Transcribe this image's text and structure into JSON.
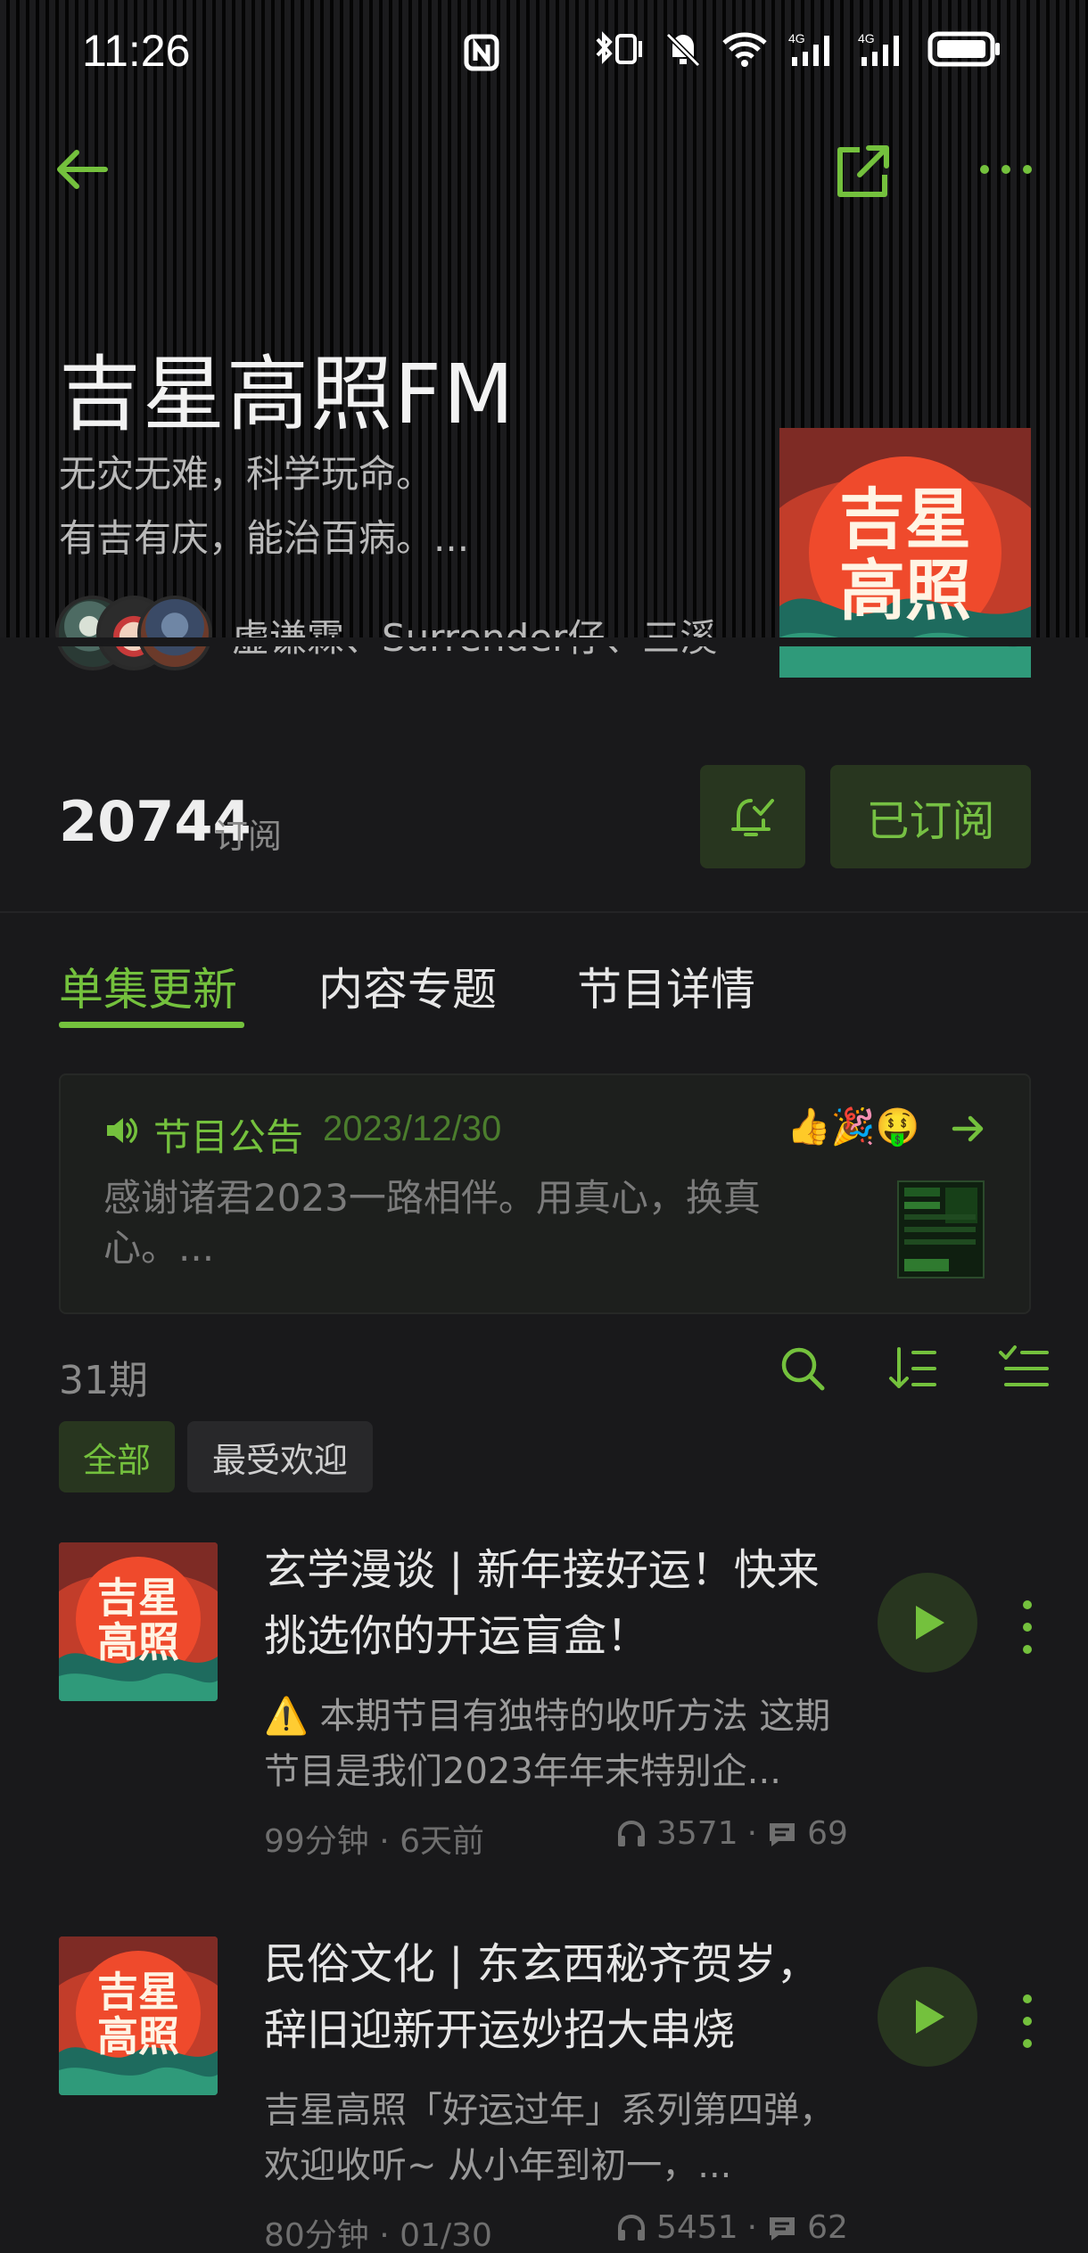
{
  "status_bar": {
    "time": "11:26"
  },
  "header": {
    "title": "吉星高照FM",
    "description_lines": [
      "无灾无难，科学玩命。",
      "有吉有庆，能治百病。..."
    ],
    "hosts": "虚谦霖、Surrender仔、三溪",
    "cover_text": [
      "吉星",
      "高照"
    ]
  },
  "subscription": {
    "count": "20744",
    "label": "订阅",
    "subscribed_label": "已订阅"
  },
  "tabs": [
    {
      "label": "单集更新",
      "active": true
    },
    {
      "label": "内容专题",
      "active": false
    },
    {
      "label": "节目详情",
      "active": false
    }
  ],
  "notice": {
    "title": "节目公告",
    "date": "2023/12/30",
    "emoji": "👍🎉🤑",
    "body": "感谢诸君2023一路相伴。用真心，换真心。..."
  },
  "episodes_header": {
    "count": "31期"
  },
  "filters": [
    {
      "label": "全部",
      "active": true
    },
    {
      "label": "最受欢迎",
      "active": false
    }
  ],
  "episodes": [
    {
      "title": "玄学漫谈 | 新年接好运！快来挑选你的开运盲盒！",
      "description": "⚠️ 本期节目有独特的收听方法 这期节目是我们2023年年末特别企...",
      "meta": "99分钟 · 6天前",
      "plays": "3571",
      "comments": "69"
    },
    {
      "title": "民俗文化 | 东玄西秘齐贺岁，辞旧迎新开运妙招大串烧",
      "description": "吉星高照「好运过年」系列第四弹，欢迎收听~ 从小年到初一，...",
      "meta": "80分钟 · 01/30",
      "plays": "5451",
      "comments": "62"
    }
  ],
  "colors": {
    "accent": "#74c13d",
    "accent_bg": "#28361f",
    "background": "#19191b"
  }
}
